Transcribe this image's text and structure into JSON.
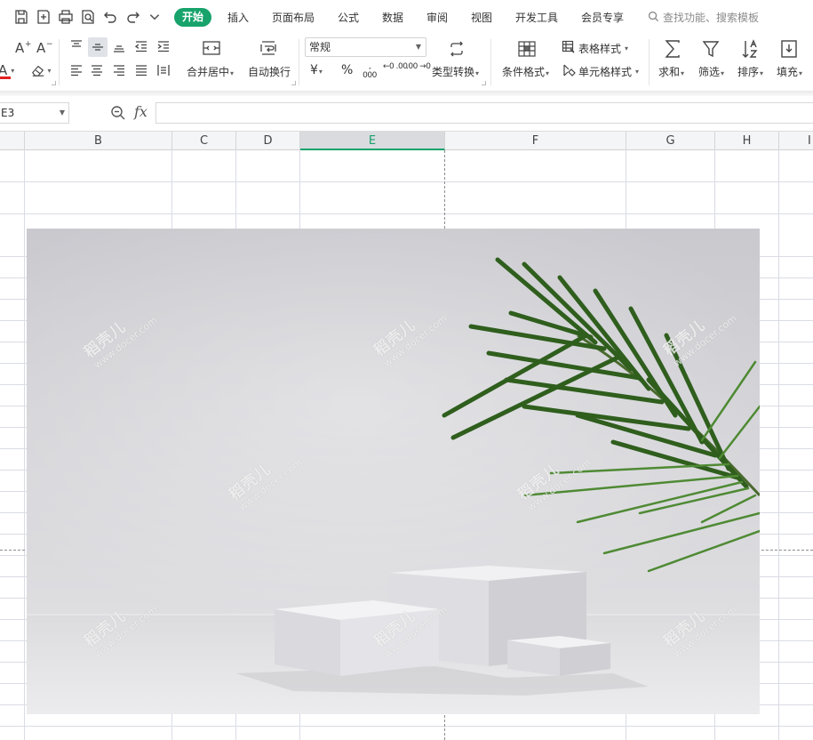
{
  "menubar": {
    "tabs": [
      {
        "label": "开始",
        "active": true
      },
      {
        "label": "插入"
      },
      {
        "label": "页面布局"
      },
      {
        "label": "公式"
      },
      {
        "label": "数据"
      },
      {
        "label": "审阅"
      },
      {
        "label": "视图"
      },
      {
        "label": "开发工具"
      },
      {
        "label": "会员专享"
      }
    ],
    "search": "查找功能、搜索模板"
  },
  "ribbon": {
    "merge_center": "合并居中",
    "wrap_text": "自动换行",
    "number_format": "常规",
    "type_convert": "类型转换",
    "conditional_format": "条件格式",
    "table_style": "表格样式",
    "cell_style": "单元格样式",
    "sum": "求和",
    "filter": "筛选",
    "sort": "排序",
    "fill": "填充",
    "currency_symbol": "¥",
    "percent_symbol": "%",
    "thousands_symbol": "000",
    "increase_decimal": "←0 .00",
    "decrease_decimal": ".00 →0",
    "font_color_symbol": "A"
  },
  "formula_bar": {
    "name_box": "E3",
    "fx": "fx",
    "formula": ""
  },
  "columns": [
    {
      "label": "B"
    },
    {
      "label": "C"
    },
    {
      "label": "D"
    },
    {
      "label": "E",
      "active": true
    },
    {
      "label": "F"
    },
    {
      "label": "G"
    },
    {
      "label": "H"
    },
    {
      "label": "I"
    }
  ],
  "picture": {
    "watermark_brand": "稻壳儿",
    "watermark_url": "www.docer.com"
  },
  "colors": {
    "accent": "#17a36b",
    "font_color_bar": "#e02020"
  }
}
